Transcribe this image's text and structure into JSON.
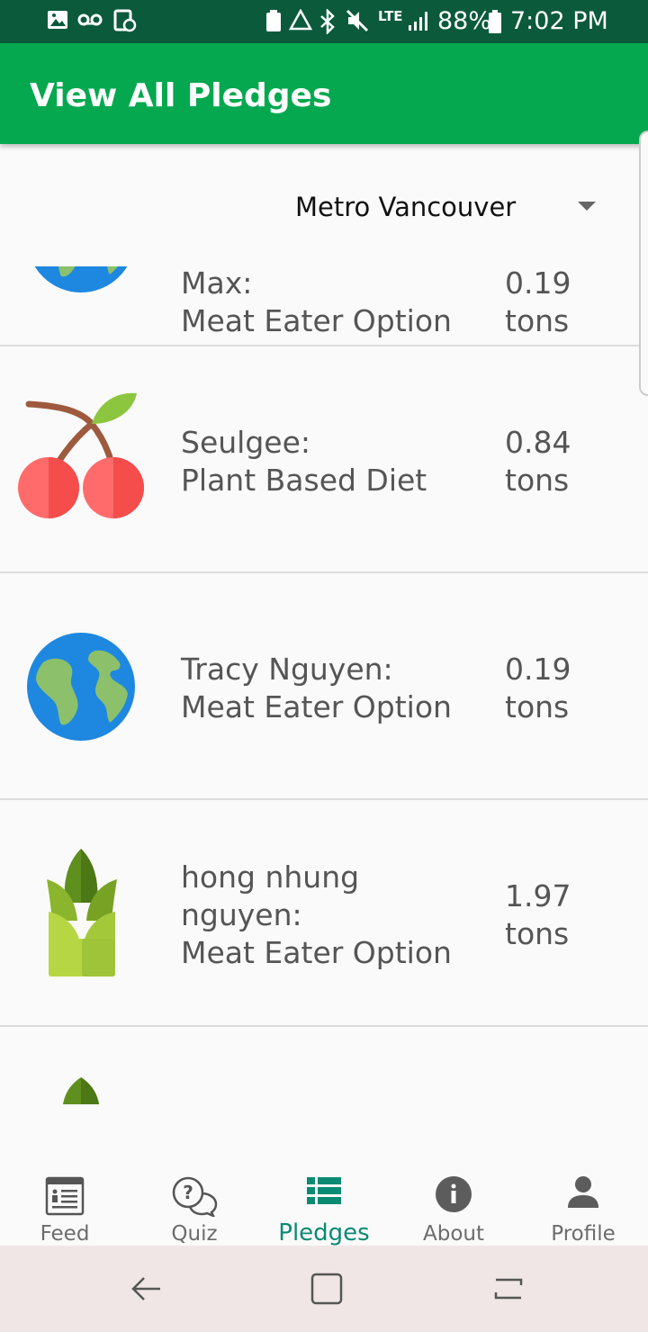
{
  "status_bar": {
    "battery": "88%",
    "time": "7:02 PM",
    "network": "LTE"
  },
  "app_bar": {
    "title": "View All Pledges"
  },
  "region_selector": {
    "value": "Metro Vancouver"
  },
  "pledges": [
    {
      "name": "Max:",
      "option": "Meat Eater Option",
      "amount": "0.19",
      "unit": "tons",
      "icon": "earth-icon"
    },
    {
      "name": "Seulgee:",
      "option": "Plant Based Diet",
      "amount": "0.84",
      "unit": "tons",
      "icon": "cherries-icon"
    },
    {
      "name": "Tracy Nguyen:",
      "option": "Meat Eater Option",
      "amount": "0.19",
      "unit": "tons",
      "icon": "earth-icon"
    },
    {
      "name_line1": "hong nhung",
      "name_line2": "nguyen:",
      "option": "Meat Eater Option",
      "amount": "1.97",
      "unit": "tons",
      "icon": "bamboo-shoot-icon"
    }
  ],
  "bottom_nav": {
    "items": [
      {
        "label": "Feed",
        "icon": "feed-icon"
      },
      {
        "label": "Quiz",
        "icon": "quiz-icon"
      },
      {
        "label": "Pledges",
        "icon": "list-icon",
        "active": true
      },
      {
        "label": "About",
        "icon": "info-icon"
      },
      {
        "label": "Profile",
        "icon": "person-icon"
      }
    ]
  },
  "colors": {
    "status_bar": "#0b5a3c",
    "app_bar": "#05a84f",
    "active_nav": "#0a8a72",
    "text_secondary": "#555555"
  }
}
